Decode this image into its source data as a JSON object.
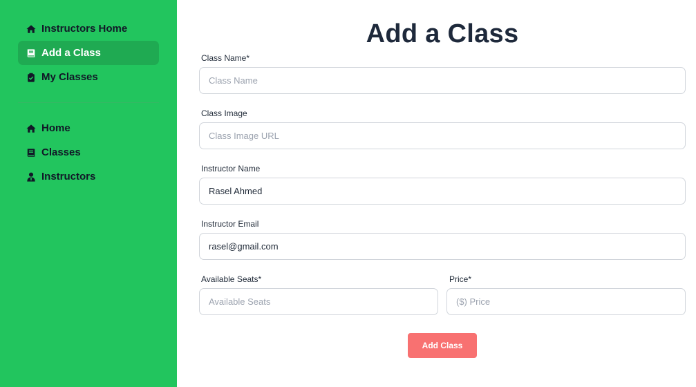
{
  "sidebar": {
    "primary_items": [
      {
        "label": "Instructors Home",
        "icon": "home-icon"
      },
      {
        "label": "Add a Class",
        "icon": "book-icon",
        "active": true
      },
      {
        "label": "My Classes",
        "icon": "clipboard-check-icon"
      }
    ],
    "secondary_items": [
      {
        "label": "Home",
        "icon": "home-icon"
      },
      {
        "label": "Classes",
        "icon": "book-icon"
      },
      {
        "label": "Instructors",
        "icon": "user-tie-icon"
      }
    ],
    "colors": {
      "background": "#22c55e",
      "active_background": "#1faa52"
    }
  },
  "form": {
    "title": "Add a Class",
    "class_name": {
      "label": "Class Name*",
      "placeholder": "Class Name",
      "value": ""
    },
    "class_image": {
      "label": "Class Image",
      "placeholder": "Class Image URL",
      "value": ""
    },
    "instructor_name": {
      "label": "Instructor Name",
      "value": "Rasel Ahmed"
    },
    "instructor_email": {
      "label": "Instructor Email",
      "value": "rasel@gmail.com"
    },
    "available_seats": {
      "label": "Available Seats*",
      "placeholder": "Available Seats",
      "value": ""
    },
    "price": {
      "label": "Price*",
      "placeholder": "($) Price",
      "value": ""
    },
    "submit_label": "Add Class",
    "submit_color": "#f87171"
  }
}
